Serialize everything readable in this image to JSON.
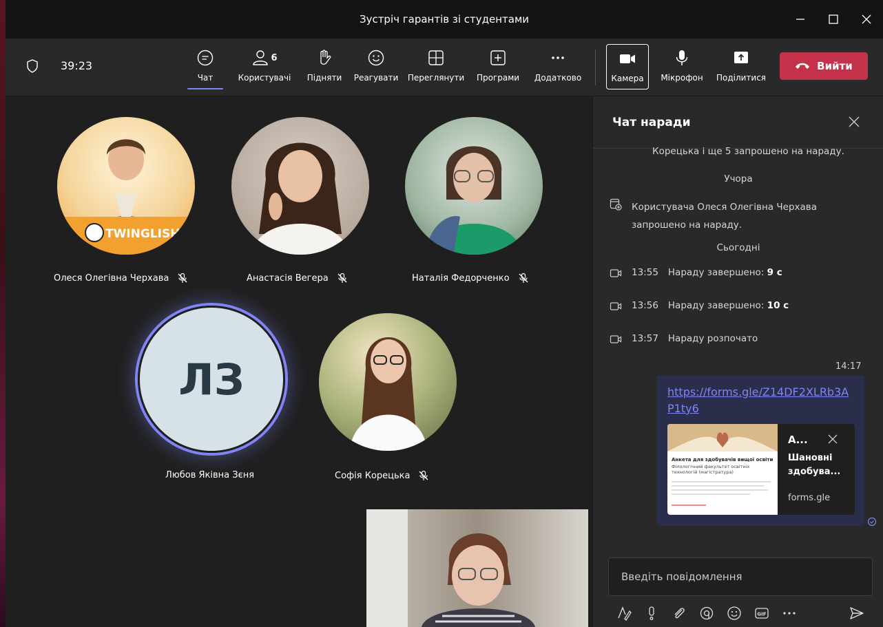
{
  "window": {
    "title": "Зустріч гарантів зі студентами"
  },
  "toolbar": {
    "timer": "39:23",
    "chat_label": "Чат",
    "people_label": "Користувачі",
    "people_count": "6",
    "raise_label": "Підняти",
    "react_label": "Реагувати",
    "view_label": "Переглянути",
    "apps_label": "Програми",
    "more_label": "Додатково",
    "camera_label": "Камера",
    "mic_label": "Мікрофон",
    "share_label": "Поділитися",
    "leave_label": "Вийти"
  },
  "participants": {
    "p1": "Олеся Олегівна Черхава",
    "p1_logo": "TWINGLISH",
    "p2": "Анастасія Вегера",
    "p3": "Наталія Федорченко",
    "p4": "Любов Яківна Зєня",
    "p4_initials": "ЛЗ",
    "p5": "Софія Корецька"
  },
  "chat": {
    "title": "Чат наради",
    "sys_truncated": "Корецька і ще 5 запрошено на нараду.",
    "day_yesterday": "Учора",
    "invite_text": "Користувача Олеся Олегівна Черхава запрошено на нараду.",
    "day_today": "Сьогодні",
    "events": [
      {
        "time": "13:55",
        "text": "Нараду завершено:",
        "dur": "9 с"
      },
      {
        "time": "13:56",
        "text": "Нараду завершено:",
        "dur": "10 с"
      },
      {
        "time": "13:57",
        "text": "Нараду розпочато",
        "dur": ""
      }
    ],
    "message_time": "14:17",
    "message_link": "https://forms.gle/Z14DF2XLRb3AP1ty6",
    "preview_title": "А...",
    "preview_desc": "Шановні здобува...",
    "preview_domain": "forms.gle",
    "thumb_title": "Анкета для здобувачів вищої освіти",
    "thumb_sub": "Філологічний факультет освітніх технологій (магістратура)",
    "compose_placeholder": "Введіть повідомлення"
  }
}
